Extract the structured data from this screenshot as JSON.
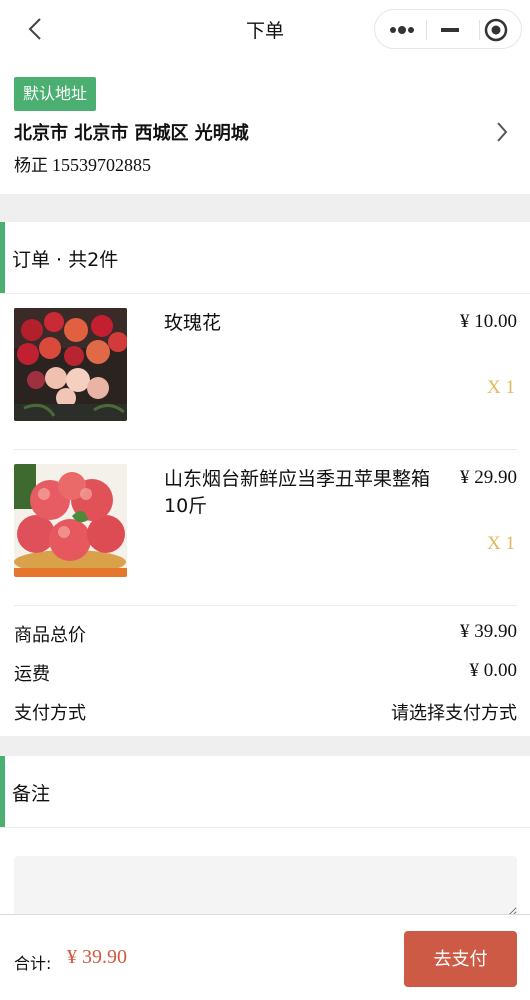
{
  "nav": {
    "title": "下单",
    "back_icon": "chevron-left-icon",
    "more_icon": "more-dots-icon",
    "minimize_icon": "minimize-icon",
    "close_icon": "target-close-icon"
  },
  "address": {
    "badge": "默认地址",
    "line": "北京市 北京市 西城区 光明城",
    "name": "杨正",
    "phone": "15539702885",
    "accent_color": "#4caf72"
  },
  "order": {
    "header": "订单 · 共2件",
    "items": [
      {
        "name": "玫瑰花",
        "price": "¥ 10.00",
        "qty": "X 1",
        "image": "roses"
      },
      {
        "name": "山东烟台新鲜应当季丑苹果整箱10斤",
        "price": "¥ 29.90",
        "qty": "X 1",
        "image": "apples"
      }
    ],
    "summary": [
      {
        "label": "商品总价",
        "value": "¥ 39.90"
      },
      {
        "label": "运费",
        "value": "¥ 0.00"
      },
      {
        "label": "支付方式",
        "value": "请选择支付方式"
      }
    ]
  },
  "remark": {
    "header": "备注",
    "placeholder": ""
  },
  "footer": {
    "total_label": "合计:",
    "total_value": "¥ 39.90",
    "pay_button": "去支付",
    "pay_color": "#cd5a45",
    "price_color": "#d05a40"
  }
}
